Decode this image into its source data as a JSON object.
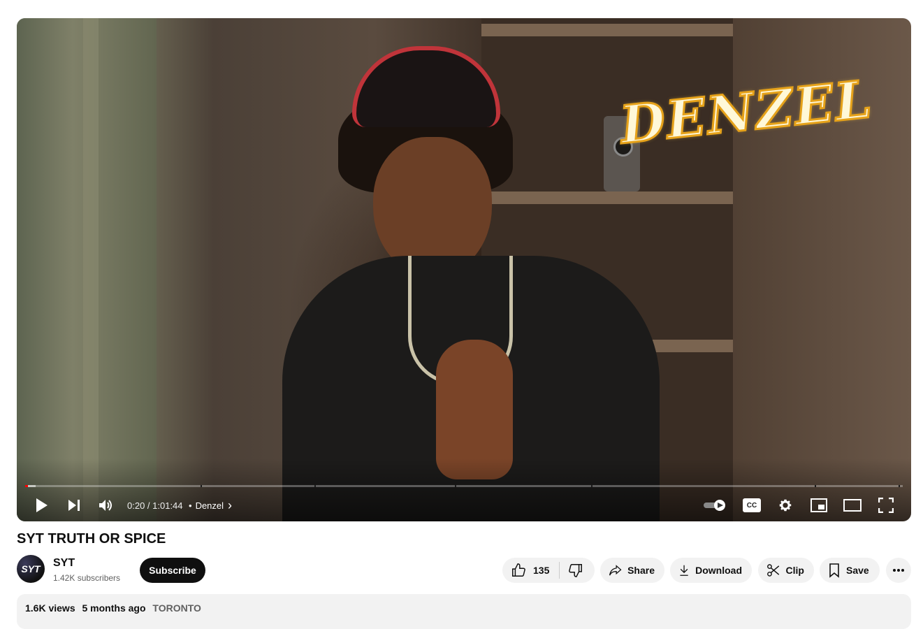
{
  "video": {
    "overlay_text": "DENZEL",
    "progress_fraction": 0.0033,
    "buffer_fraction": 0.012,
    "chapter_marks": [
      0.2,
      0.33,
      0.49,
      0.645,
      0.9,
      0.995
    ],
    "time_text": "0:20 / 1:01:44",
    "chapter_sep": "•",
    "chapter_label": "Denzel",
    "chapter_chevron": "›"
  },
  "icons": {
    "play": "play-icon",
    "next": "next-icon",
    "volume": "volume-icon",
    "autoplay": "autoplay-toggle-icon",
    "cc": "captions-icon",
    "settings": "gear-icon",
    "miniplayer": "miniplayer-icon",
    "theater": "theater-mode-icon",
    "fullscreen": "fullscreen-icon"
  },
  "cc_label": "CC",
  "title": "SYT TRUTH OR SPICE",
  "channel": {
    "avatar_text": "SYT",
    "name": "SYT",
    "subscribers": "1.42K subscribers",
    "subscribe_label": "Subscribe"
  },
  "actions": {
    "like_count": "135",
    "share_label": "Share",
    "download_label": "Download",
    "clip_label": "Clip",
    "save_label": "Save"
  },
  "description": {
    "views": "1.6K views",
    "age": "5 months ago",
    "tag": "TORONTO"
  },
  "colors": {
    "progress": "#ff0000",
    "overlay_stroke": "#e6a21a",
    "cap_brim": "#c0343a"
  }
}
